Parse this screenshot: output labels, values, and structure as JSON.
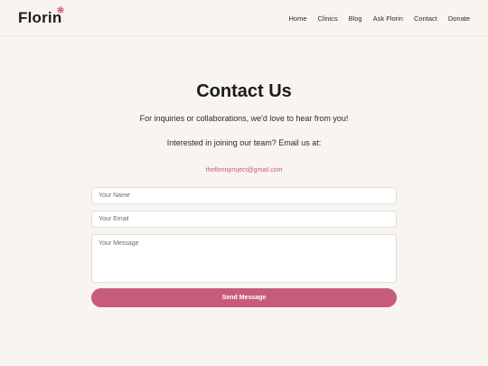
{
  "header": {
    "logo_text": "Florin",
    "logo_icon": "flower-icon",
    "nav": [
      {
        "label": "Home"
      },
      {
        "label": "Clinics"
      },
      {
        "label": "Blog"
      },
      {
        "label": "Ask Florin"
      },
      {
        "label": "Contact"
      },
      {
        "label": "Donate"
      }
    ]
  },
  "main": {
    "title": "Contact Us",
    "subtitle": "For inquiries or collaborations, we'd love to hear from you!",
    "join_text": "Interested in joining our team? Email us at:",
    "email": "theflorinproject@gmail.com"
  },
  "form": {
    "name_placeholder": "Your Name",
    "email_placeholder": "Your Email",
    "message_placeholder": "Your Message",
    "submit_label": "Send Message"
  },
  "colors": {
    "accent": "#c75b7c",
    "background": "#f8f5f1"
  }
}
